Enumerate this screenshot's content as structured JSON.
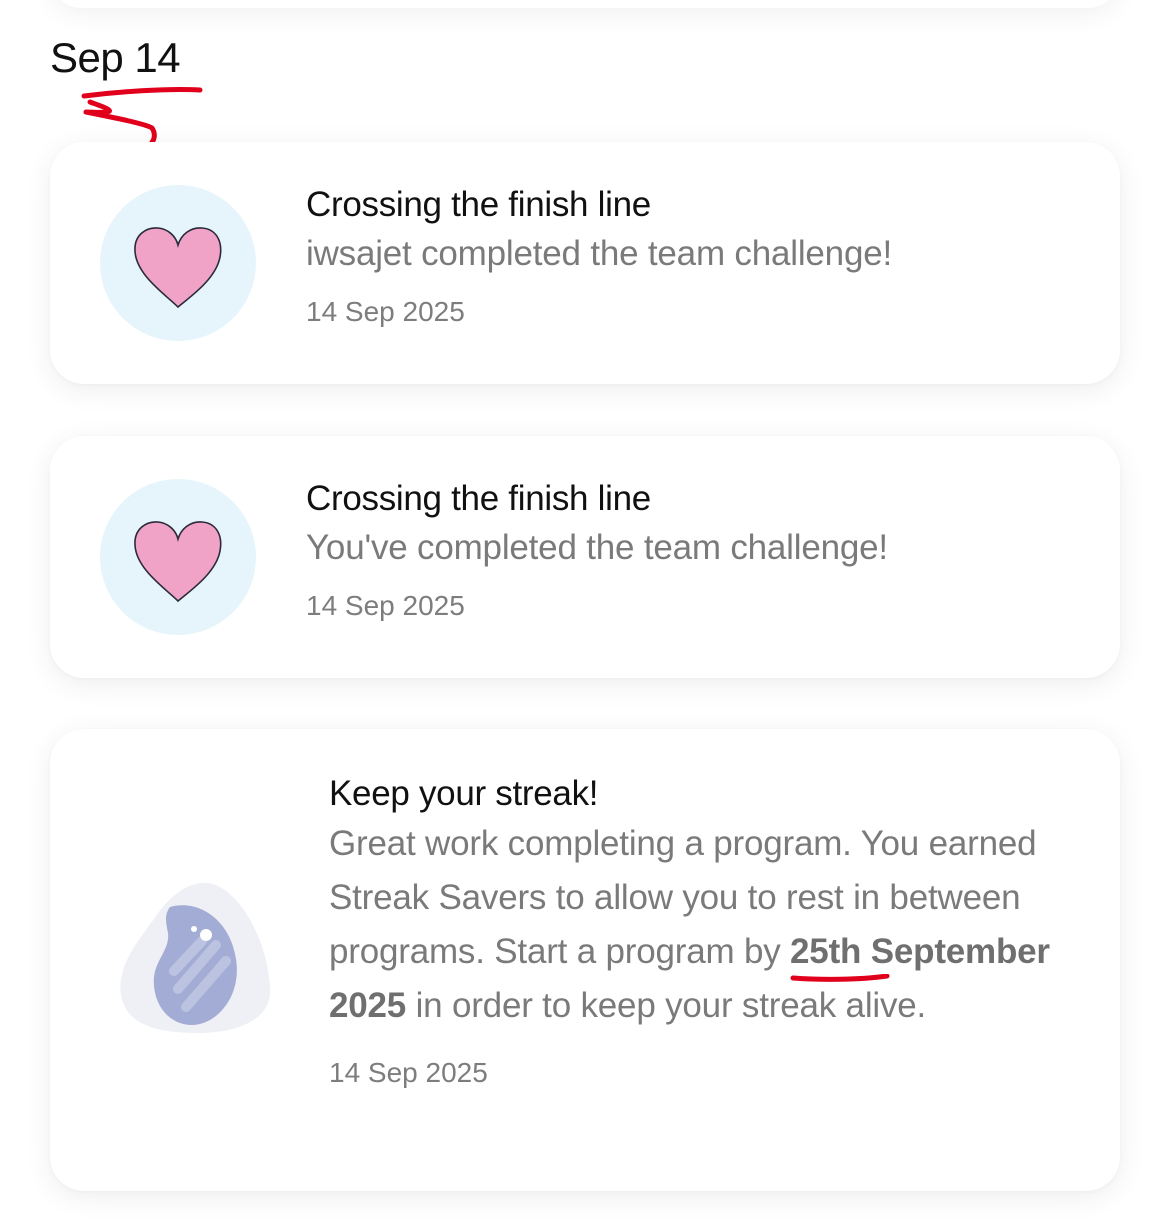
{
  "section": {
    "date_label": "Sep 14"
  },
  "notifications": [
    {
      "title": "Crossing the finish line",
      "message": "iwsajet completed the team challenge!",
      "date": "14 Sep 2025",
      "icon": "heart-icon"
    },
    {
      "title": "Crossing the finish line",
      "message": "You've completed the team challenge!",
      "date": "14 Sep 2025",
      "icon": "heart-icon"
    },
    {
      "title": "Keep your streak!",
      "message_part1": "Great work completing a program. You earned Streak Savers to allow you to rest in between programs. Start a program by ",
      "message_bold": "25th September 2025",
      "message_part2": " in order to keep your streak alive.",
      "date": "14 Sep 2025",
      "icon": "flame-icon"
    }
  ],
  "colors": {
    "heart_fill": "#f0a3c7",
    "avatar_bg": "#e6f5fc",
    "flame_fill": "#a3acd4",
    "annotation_red": "#e0001b"
  }
}
